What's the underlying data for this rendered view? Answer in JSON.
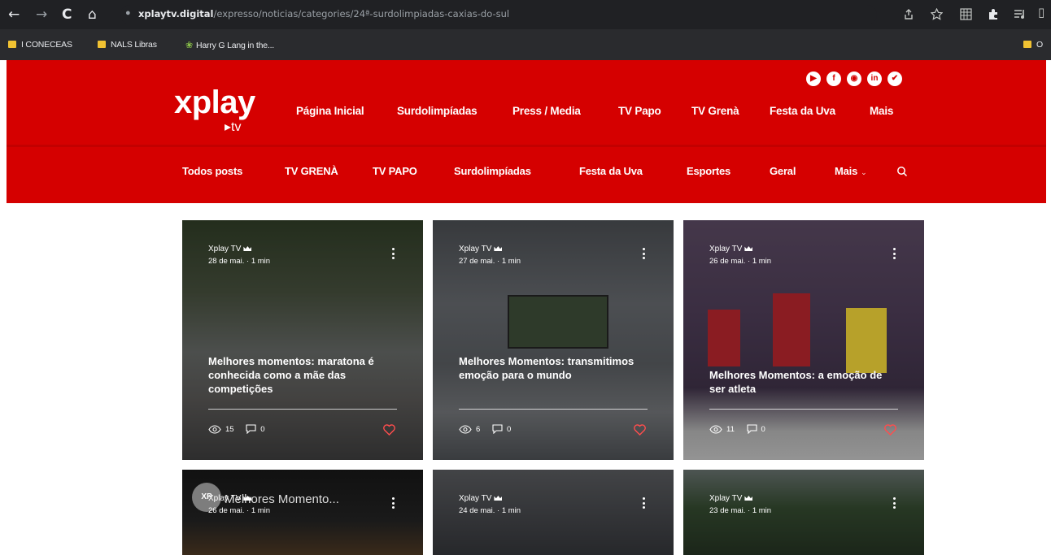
{
  "browser": {
    "back": "←",
    "forward": "→",
    "reload": "C",
    "home": "⌂",
    "url_domain": "xplaytv.digital",
    "url_path": "/expresso/noticias/categories/24ª-surdolimpiadas-caxias-do-sul",
    "right_icons": [
      "share-icon",
      "star-icon",
      "grid-icon",
      "extension-icon",
      "media-icon"
    ]
  },
  "bookmarks": [
    {
      "label": "I CONECEAS",
      "icon": "folder-icon"
    },
    {
      "label": "NALS Libras",
      "icon": "folder-icon"
    },
    {
      "label": "Harry G Lang in the...",
      "icon": "leaf-icon"
    },
    {
      "label": "O",
      "icon": "folder-icon"
    }
  ],
  "header": {
    "logo_main": "xplay",
    "logo_sub": "▸tv",
    "social": [
      "youtube-icon",
      "facebook-icon",
      "instagram-icon",
      "linkedin-icon",
      "twitter-icon"
    ],
    "nav_primary": [
      "Página Inicial",
      "Surdolimpíadas",
      "Press / Media",
      "TV Papo",
      "TV Grenà",
      "Festa da Uva",
      "Mais"
    ],
    "nav_secondary": [
      "Todos posts",
      "TV GRENÀ",
      "TV PAPO",
      "Surdolimpíadas",
      "Festa da Uva",
      "Esportes",
      "Geral",
      "Mais"
    ]
  },
  "colors": {
    "brand_red": "#d50000",
    "heart": "#ff4d4d"
  },
  "posts": [
    {
      "author": "Xplay TV",
      "date": "28 de mai.",
      "read_time": "1 min",
      "title": "Melhores momentos: maratona é conhecida como a mãe das competições",
      "views": "15",
      "comments": "0"
    },
    {
      "author": "Xplay TV",
      "date": "27 de mai.",
      "read_time": "1 min",
      "title": "Melhores Momentos: transmitimos emoção para o mundo",
      "views": "6",
      "comments": "0"
    },
    {
      "author": "Xplay TV",
      "date": "26 de mai.",
      "read_time": "1 min",
      "title": "Melhores Momentos: a emoção de ser atleta",
      "views": "11",
      "comments": "0"
    },
    {
      "author": "Xplay TV",
      "date": "26 de mai.",
      "read_time": "1 min",
      "overlay_title": "Melhores Momento...",
      "avatar": "XP"
    },
    {
      "author": "Xplay TV",
      "date": "24 de mai.",
      "read_time": "1 min"
    },
    {
      "author": "Xplay TV",
      "date": "23 de mai.",
      "read_time": "1 min"
    }
  ]
}
